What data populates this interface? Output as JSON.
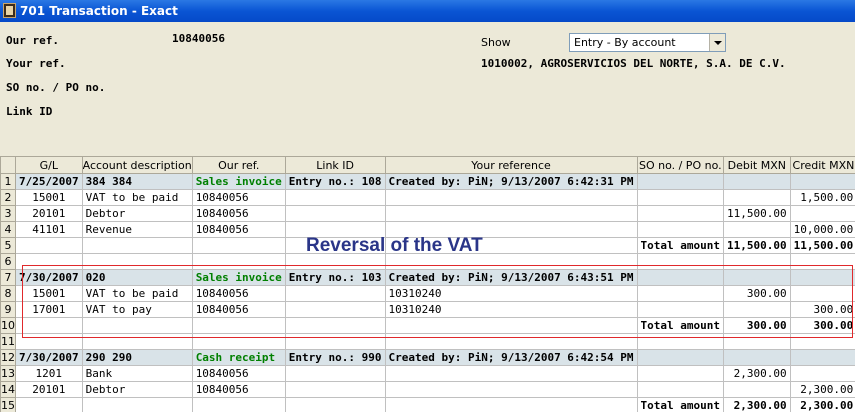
{
  "window": {
    "title": "701 Transaction - Exact"
  },
  "header": {
    "our_ref_label": "Our ref.",
    "our_ref_value": "10840056",
    "your_ref_label": "Your ref.",
    "so_po_label": "SO no. / PO no.",
    "link_id_label": "Link ID",
    "show_label": "Show",
    "show_value": "Entry - By account",
    "customer": "1010002, AGROSERVICIOS DEL NORTE, S.A. DE C.V."
  },
  "grid": {
    "columns": [
      "G/L",
      "Account description",
      "Our ref.",
      "Link ID",
      "Your reference",
      "SO no. / PO no.",
      "Debit MXN",
      "Credit MXN"
    ],
    "rows": [
      {
        "n": "1",
        "type": "group",
        "gl": "7/25/2007",
        "desc": "384 384",
        "ref": "Sales invoice",
        "link": "Entry no.: 108",
        "yref": "Created by: PiN; 9/13/2007 6:42:31 PM",
        "so": "",
        "debit": "",
        "credit": ""
      },
      {
        "n": "2",
        "type": "line",
        "gl": "15001",
        "desc": "VAT to be paid",
        "ref": "10840056",
        "link": "",
        "yref": "",
        "so": "",
        "debit": "",
        "credit": "1,500.00"
      },
      {
        "n": "3",
        "type": "line",
        "gl": "20101",
        "desc": "Debtor",
        "ref": "10840056",
        "link": "",
        "yref": "",
        "so": "",
        "debit": "11,500.00",
        "credit": ""
      },
      {
        "n": "4",
        "type": "line",
        "gl": "41101",
        "desc": "Revenue",
        "ref": "10840056",
        "link": "",
        "yref": "",
        "so": "",
        "debit": "",
        "credit": "10,000.00"
      },
      {
        "n": "5",
        "type": "total",
        "gl": "",
        "desc": "",
        "ref": "",
        "link": "",
        "yref": "",
        "so": "Total amount",
        "debit": "11,500.00",
        "credit": "11,500.00"
      },
      {
        "n": "6",
        "type": "blank",
        "gl": "",
        "desc": "",
        "ref": "",
        "link": "",
        "yref": "",
        "so": "",
        "debit": "",
        "credit": ""
      },
      {
        "n": "7",
        "type": "group",
        "gl": "7/30/2007",
        "desc": "020",
        "ref": "Sales invoice",
        "link": "Entry no.: 103",
        "yref": "Created by: PiN; 9/13/2007 6:43:51 PM",
        "so": "",
        "debit": "",
        "credit": ""
      },
      {
        "n": "8",
        "type": "line",
        "gl": "15001",
        "desc": "VAT to be paid",
        "ref": "10840056",
        "link": "",
        "yref": "10310240",
        "so": "",
        "debit": "300.00",
        "credit": ""
      },
      {
        "n": "9",
        "type": "line",
        "gl": "17001",
        "desc": "VAT to pay",
        "ref": "10840056",
        "link": "",
        "yref": "10310240",
        "so": "",
        "debit": "",
        "credit": "300.00"
      },
      {
        "n": "10",
        "type": "total",
        "gl": "",
        "desc": "",
        "ref": "",
        "link": "",
        "yref": "",
        "so": "Total amount",
        "debit": "300.00",
        "credit": "300.00"
      },
      {
        "n": "11",
        "type": "blank",
        "gl": "",
        "desc": "",
        "ref": "",
        "link": "",
        "yref": "",
        "so": "",
        "debit": "",
        "credit": ""
      },
      {
        "n": "12",
        "type": "group",
        "gl": "7/30/2007",
        "desc": "290 290",
        "ref": "Cash receipt",
        "link": "Entry no.: 990",
        "yref": "Created by: PiN; 9/13/2007 6:42:54 PM",
        "so": "",
        "debit": "",
        "credit": ""
      },
      {
        "n": "13",
        "type": "line",
        "gl": "1201",
        "desc": "Bank",
        "ref": "10840056",
        "link": "",
        "yref": "",
        "so": "",
        "debit": "2,300.00",
        "credit": ""
      },
      {
        "n": "14",
        "type": "line",
        "gl": "20101",
        "desc": "Debtor",
        "ref": "10840056",
        "link": "",
        "yref": "",
        "so": "",
        "debit": "",
        "credit": "2,300.00"
      },
      {
        "n": "15",
        "type": "total",
        "gl": "",
        "desc": "",
        "ref": "",
        "link": "",
        "yref": "",
        "so": "Total amount",
        "debit": "2,300.00",
        "credit": "2,300.00"
      }
    ]
  },
  "annotation": {
    "text": "Reversal of the VAT"
  }
}
